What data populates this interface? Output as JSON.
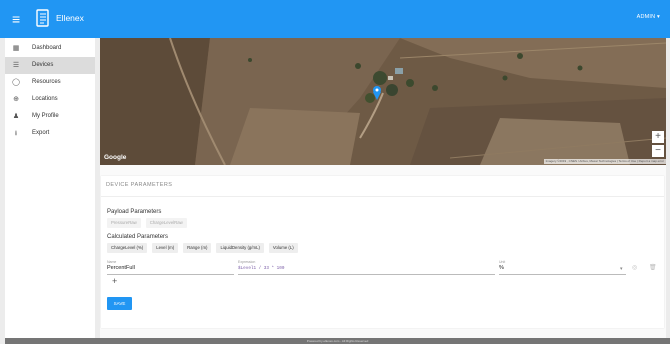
{
  "header": {
    "menu_icon": "menu-icon",
    "logo_icon": "book-logo-icon",
    "brand": "Ellenex",
    "user_label": "ADMIN ▾"
  },
  "sidebar": {
    "items": [
      {
        "label": "Dashboard",
        "icon": "dashboard-icon",
        "glyph": "▦"
      },
      {
        "label": "Devices",
        "icon": "devices-icon",
        "glyph": "☰"
      },
      {
        "label": "Resources",
        "icon": "resources-icon",
        "glyph": "◯"
      },
      {
        "label": "Locations",
        "icon": "location-icon",
        "glyph": "⊕"
      },
      {
        "label": "My Profile",
        "icon": "person-icon",
        "glyph": "♟"
      },
      {
        "label": "Export",
        "icon": "download-icon",
        "glyph": "⭳"
      }
    ],
    "active_index": 1
  },
  "map": {
    "provider": "Google",
    "attribution": "Imagery ©2019 , CNES / Airbus, Maxar Technologies | Terms of Use | Report a map error",
    "zoom_in": "+",
    "zoom_out": "−"
  },
  "device_parameters": {
    "title": "DEVICE PARAMETERS",
    "payload_heading": "Payload Parameters",
    "payload_chips": [
      "PressureRaw",
      "ChargeLevelRaw"
    ],
    "calculated_heading": "Calculated Parameters",
    "calculated_chips": [
      "ChargeLevel (%)",
      "Level (m)",
      "Range (m)",
      "LiquidDensity (g/mL)",
      "Volume (L)"
    ],
    "row": {
      "name_label": "Name",
      "name_value": "PercentFull",
      "expression_label": "Expression",
      "expression_value": "$Level1 / 33 * 100",
      "unit_label": "Unit",
      "unit_value": "%"
    },
    "add_label": "+",
    "save_label": "SAVE"
  },
  "footer": {
    "text": "Powered by ellenex.com - All Rights Reserved"
  },
  "colors": {
    "primary": "#2196f3",
    "sidebar_active": "#dcdcdc",
    "expression_text": "#7b5ea7",
    "footer": "#757575"
  }
}
